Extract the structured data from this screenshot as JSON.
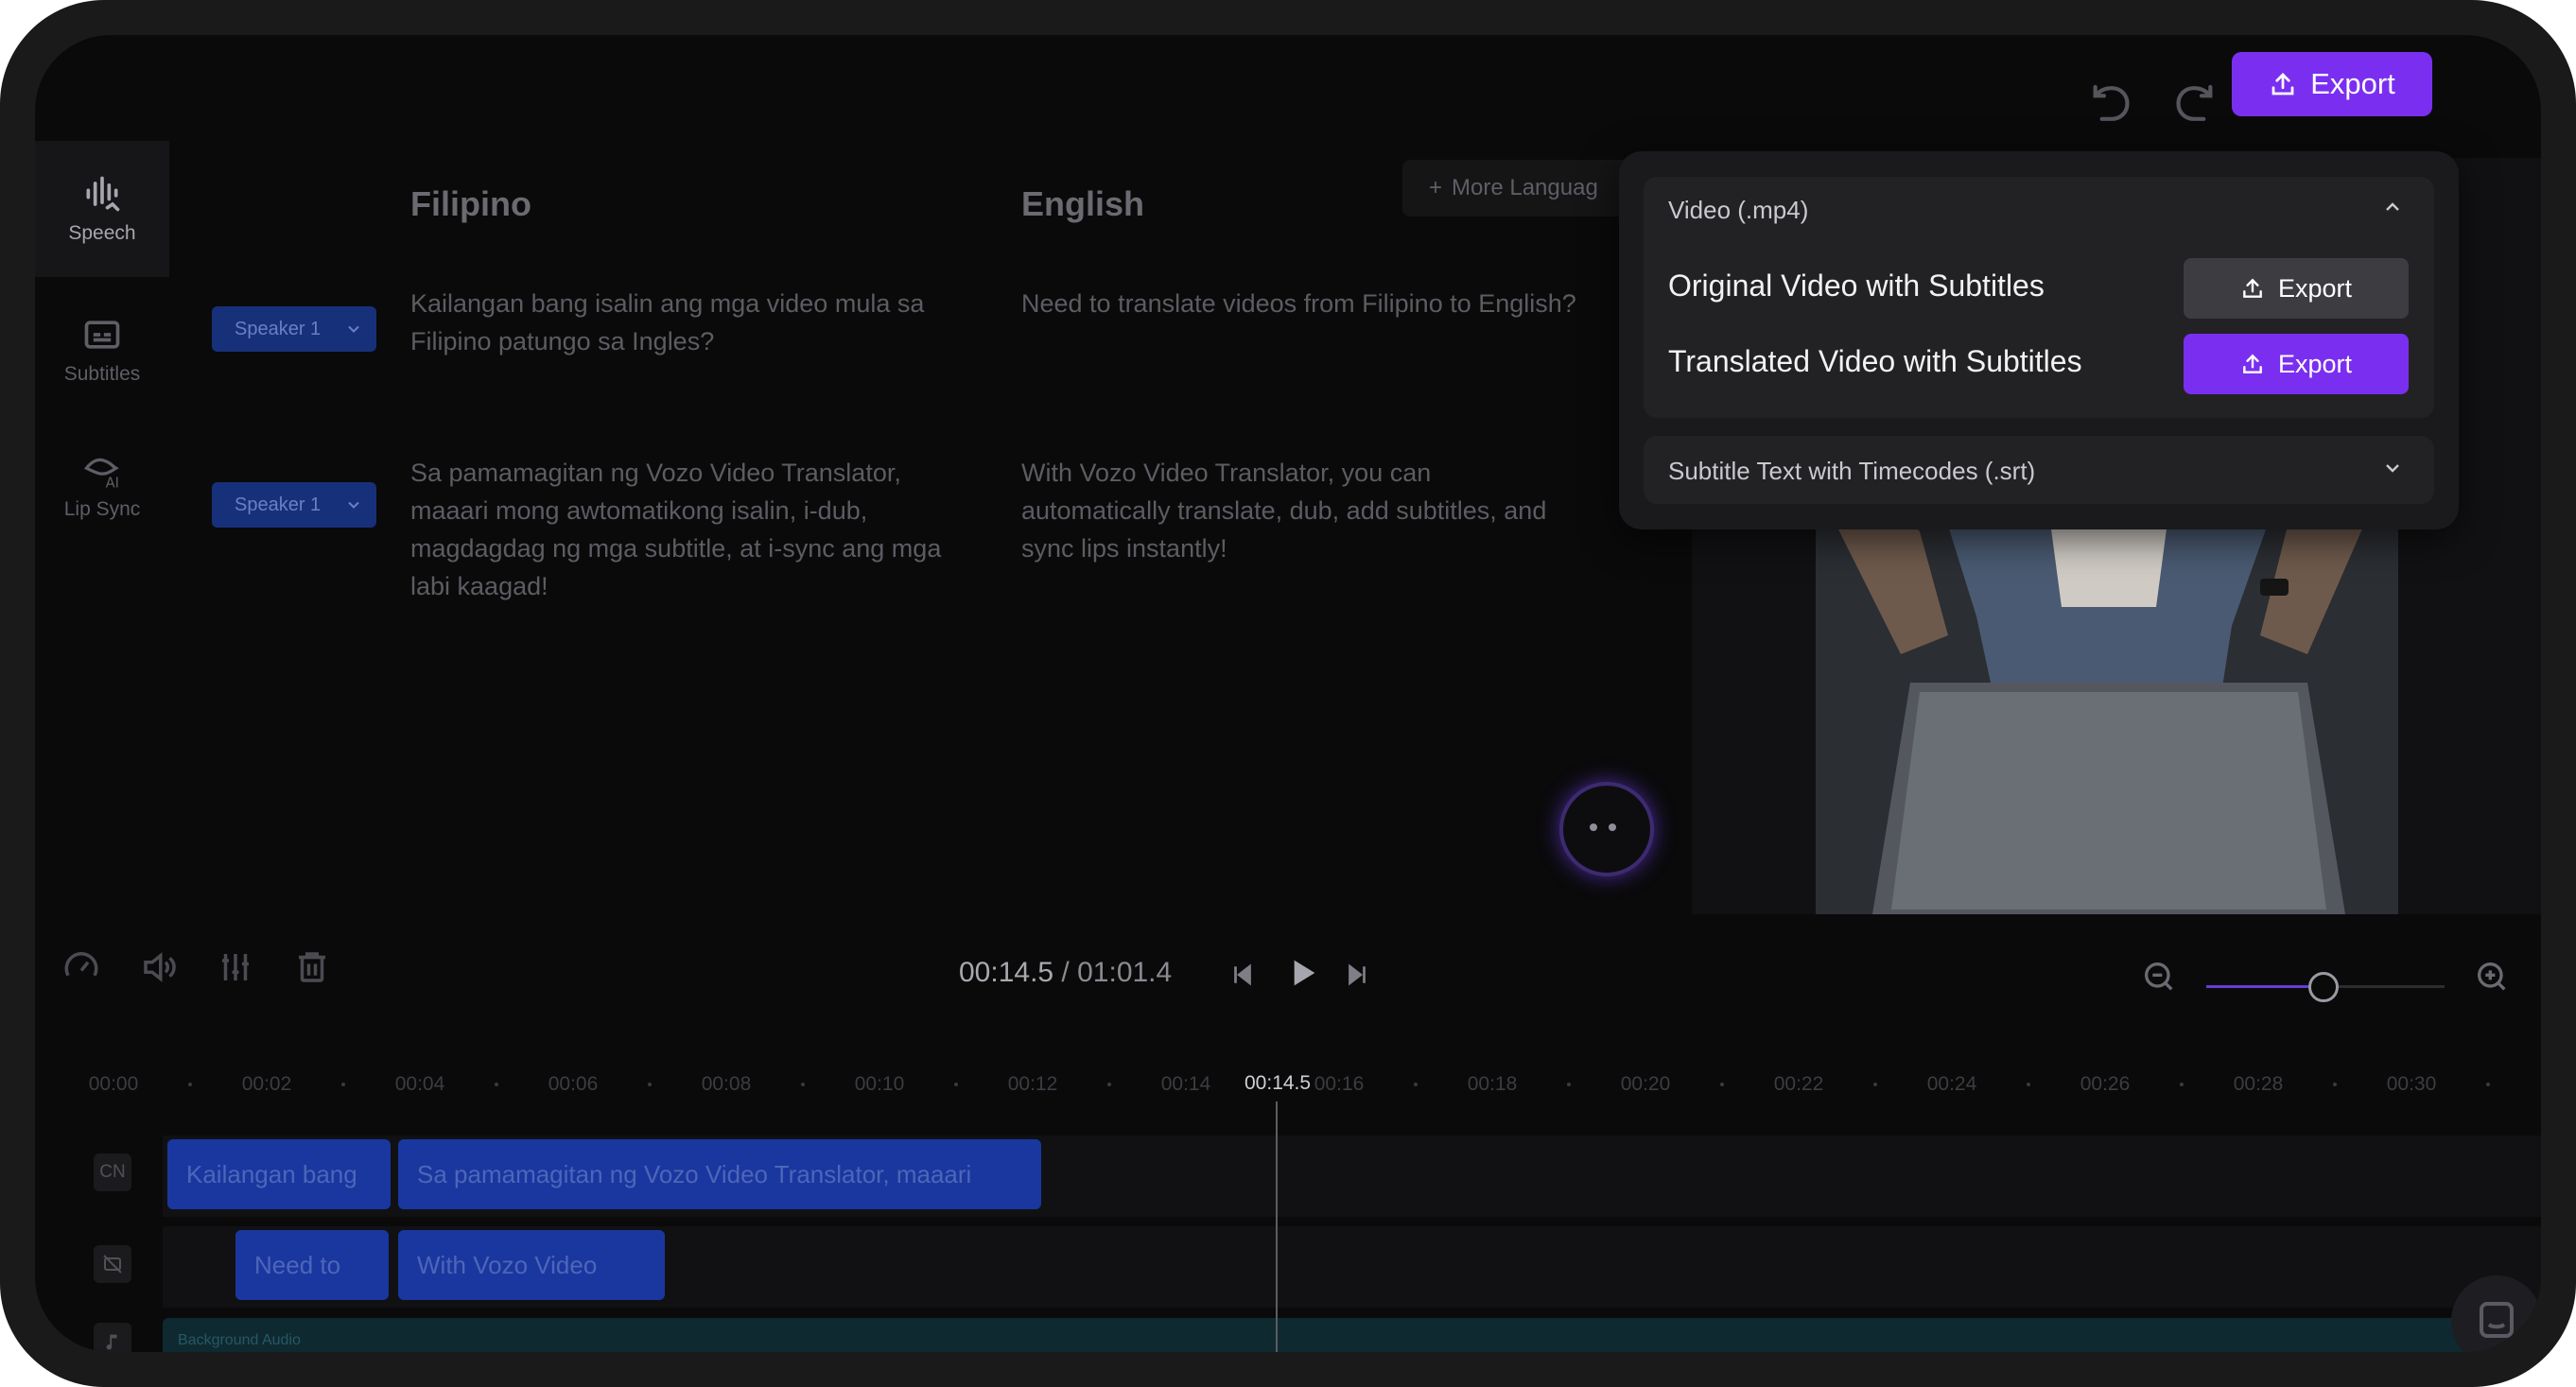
{
  "toolbar": {
    "export_label": "Export"
  },
  "rail": {
    "items": [
      {
        "label": "Speech",
        "icon": "speech-waveform-icon",
        "active": true
      },
      {
        "label": "Subtitles",
        "icon": "subtitles-icon",
        "active": false
      },
      {
        "label": "Lip Sync",
        "icon": "lip-sync-ai-icon",
        "active": false
      }
    ]
  },
  "script": {
    "source_language": "Filipino",
    "target_language": "English",
    "more_languages_label": "More Languag",
    "rows": [
      {
        "speaker": "Speaker 1",
        "source": "Kailangan bang isalin ang mga video mula sa Filipino patungo sa Ingles?",
        "target": "Need to translate videos from Filipino to English?"
      },
      {
        "speaker": "Speaker 1",
        "source": "Sa pamamagitan ng Vozo Video Translator, maaari mong awtomatikong isalin, i-dub, magdagdag ng mga subtitle, at i-sync ang mga labi kaagad!",
        "target": "With Vozo Video Translator, you can automatically translate, dub, add subtitles, and sync lips instantly!"
      }
    ]
  },
  "export_menu": {
    "video_section_title": "Video (.mp4)",
    "options": [
      {
        "label": "Original Video with Subtitles",
        "button": "Export"
      },
      {
        "label": "Translated Video with Subtitles",
        "button": "Export"
      }
    ],
    "srt_section_title": "Subtitle Text with Timecodes (.srt)"
  },
  "player": {
    "current_time": "00:14.5",
    "separator": " / ",
    "total_time": "01:01.4",
    "zoom_level": 0.5
  },
  "timeline": {
    "ticks": [
      "00:00",
      "00:02",
      "00:04",
      "00:06",
      "00:08",
      "00:10",
      "00:12",
      "00:14",
      "00:16",
      "00:18",
      "00:20",
      "00:22",
      "00:24",
      "00:26",
      "00:28",
      "00:30"
    ],
    "playhead_label": "00:14.5",
    "tracks": [
      {
        "tag": "CN",
        "clips": [
          "Kailangan bang",
          "Sa pamamagitan ng Vozo Video Translator, maaari"
        ]
      },
      {
        "tag": "",
        "clips": [
          "Need to",
          "With Vozo Video"
        ]
      }
    ],
    "audio_label": "Background Audio"
  },
  "colors": {
    "accent": "#7a2ff0",
    "clip": "#1a37a0",
    "audio_track": "#0e2a30"
  }
}
